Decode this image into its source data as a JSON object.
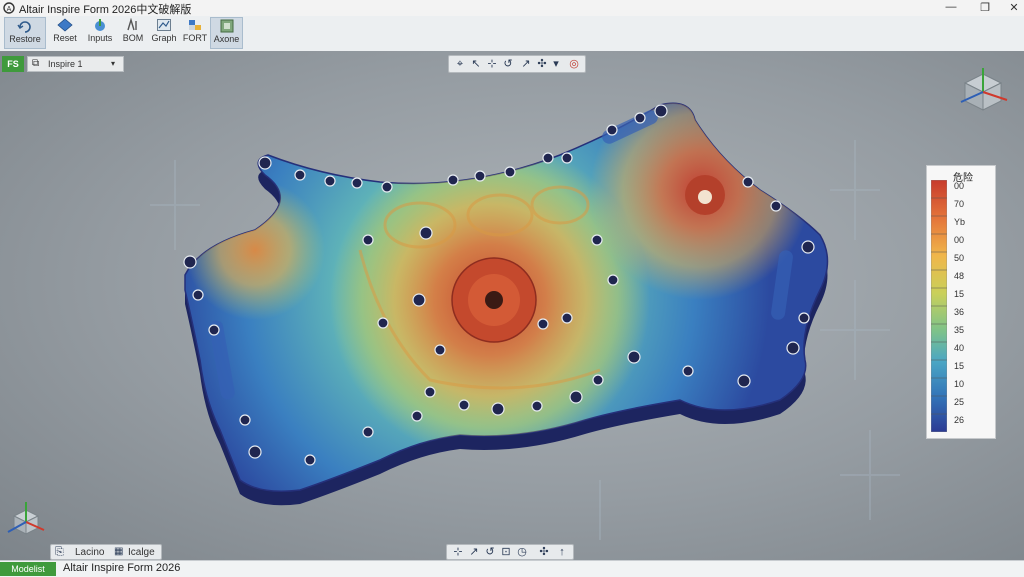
{
  "window": {
    "title": "Altair Inspire Form 2026中文破解版",
    "controls": {
      "minimize": "—",
      "maximize": "❐",
      "close": "✕"
    }
  },
  "ribbon": {
    "items": [
      {
        "label": "Restore",
        "icon": "restore-icon",
        "active": true
      },
      {
        "label": "Reset",
        "icon": "reset-icon",
        "active": false
      },
      {
        "label": "Inputs",
        "icon": "inputs-icon",
        "active": false
      },
      {
        "label": "BOM",
        "icon": "bom-icon",
        "active": false
      },
      {
        "label": "Graph",
        "icon": "graph-icon",
        "active": false
      },
      {
        "label": "FORT",
        "icon": "fort-icon",
        "active": false
      },
      {
        "label": "Axone",
        "icon": "axone-icon",
        "active": true
      }
    ]
  },
  "modebar": {
    "mode_label": "FS",
    "dropdown_label": "Inspire 1"
  },
  "legend": {
    "title": "危险",
    "ticks": [
      "00",
      "70",
      "Yb",
      "00",
      "50",
      "48",
      "15",
      "36",
      "35",
      "40",
      "15",
      "10",
      "25",
      "26"
    ],
    "colors": [
      "#c73b2c",
      "#e4743a",
      "#f0b64a",
      "#c9d05a",
      "#7dc28a",
      "#4ba6c4",
      "#3274b8",
      "#2c3a94"
    ]
  },
  "bottom_tabs": {
    "labels": [
      "Lacino",
      "Icalge"
    ]
  },
  "status": {
    "mode": "Modelist",
    "app_name": "Altair Inspire Form 2026"
  },
  "colors": {
    "accent_green": "#3f9a3c",
    "hot": "#c73b2c",
    "cold": "#2c3a94"
  }
}
